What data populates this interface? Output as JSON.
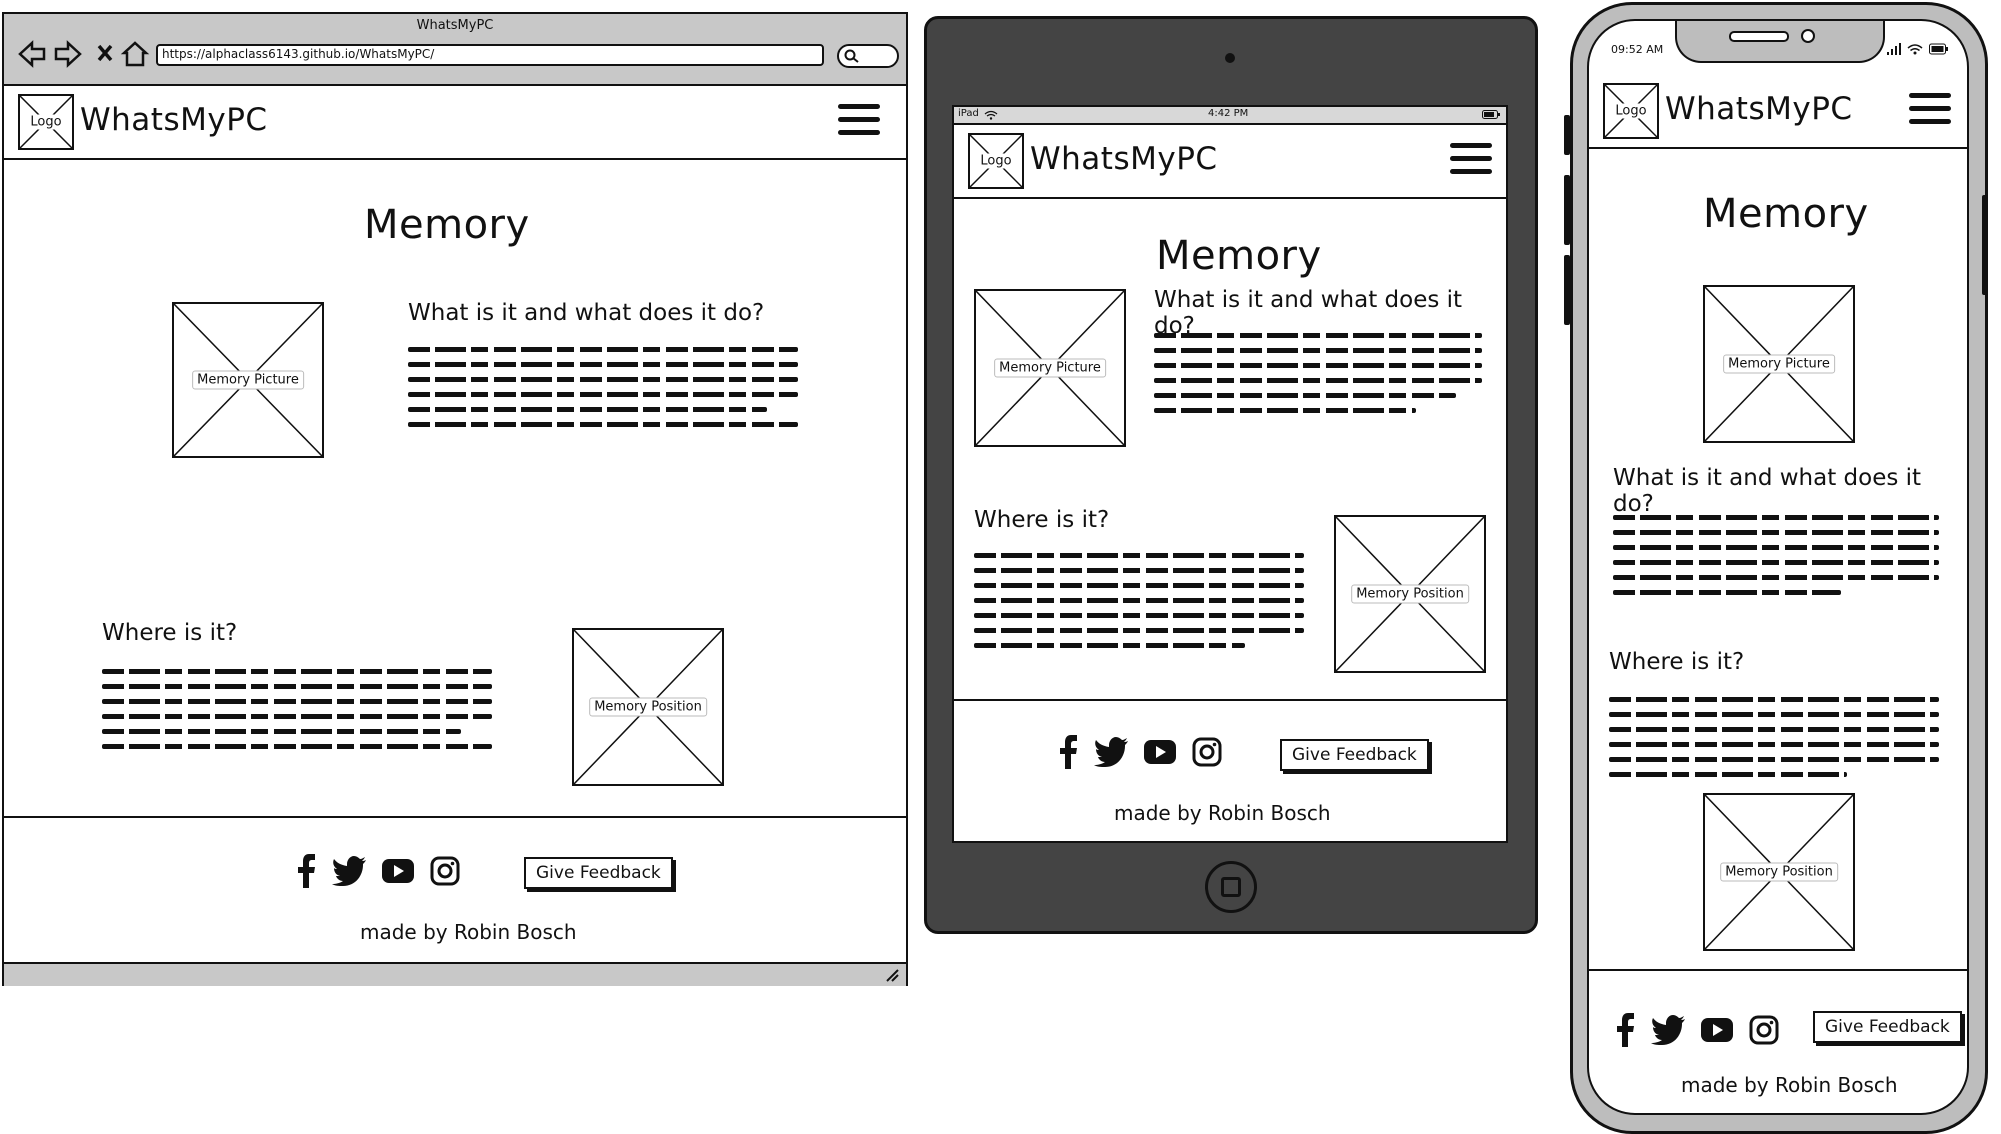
{
  "browser": {
    "window_title": "WhatsMyPC",
    "url": "https://alphaclass6143.github.io/WhatsMyPC/"
  },
  "site": {
    "logo_label": "Logo",
    "brand": "WhatsMyPC",
    "page_heading": "Memory",
    "section1_heading": "What is it and what does it do?",
    "section2_heading": "Where is it?",
    "picture1_caption": "Memory Picture",
    "picture2_caption": "Memory Position",
    "feedback_button": "Give Feedback",
    "credit": "made by Robin Bosch",
    "social_icons": [
      "facebook-icon",
      "twitter-icon",
      "youtube-icon",
      "instagram-icon"
    ]
  },
  "tablet": {
    "carrier": "iPad",
    "time": "4:42 PM"
  },
  "phone": {
    "time": "09:52 AM"
  }
}
